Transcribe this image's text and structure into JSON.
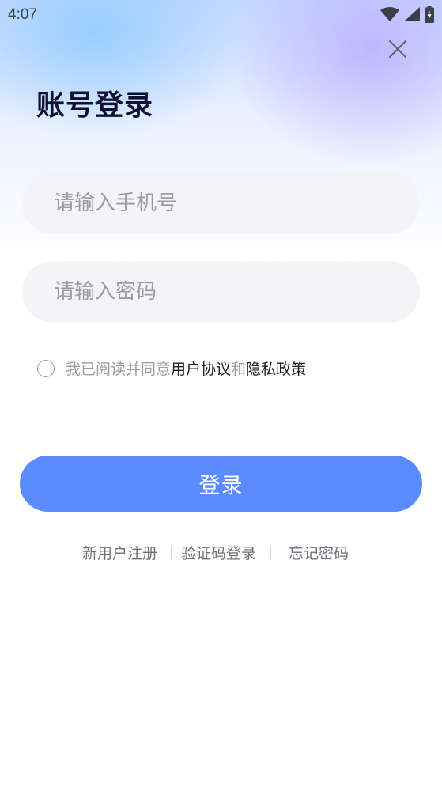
{
  "status_bar": {
    "time": "4:07",
    "icons": [
      "wifi-icon",
      "signal-icon",
      "battery-icon"
    ]
  },
  "header": {
    "close_icon": "close-icon",
    "title": "账号登录"
  },
  "form": {
    "phone_placeholder": "请输入手机号",
    "phone_value": "",
    "password_placeholder": "请输入密码",
    "password_value": ""
  },
  "agreement": {
    "checked": false,
    "prefix": "我已阅读并同意",
    "user_agreement": "用户协议",
    "conjunction": "和",
    "privacy_policy": "隐私政策"
  },
  "login_button": {
    "label": "登录"
  },
  "links": {
    "register": "新用户注册",
    "sms_login": "验证码登录",
    "forgot_password": "忘记密码"
  },
  "colors": {
    "primary": "#5a8bff",
    "title": "#0d1030",
    "placeholder": "#9a9ca4",
    "field_bg": "#f4f4f7"
  }
}
